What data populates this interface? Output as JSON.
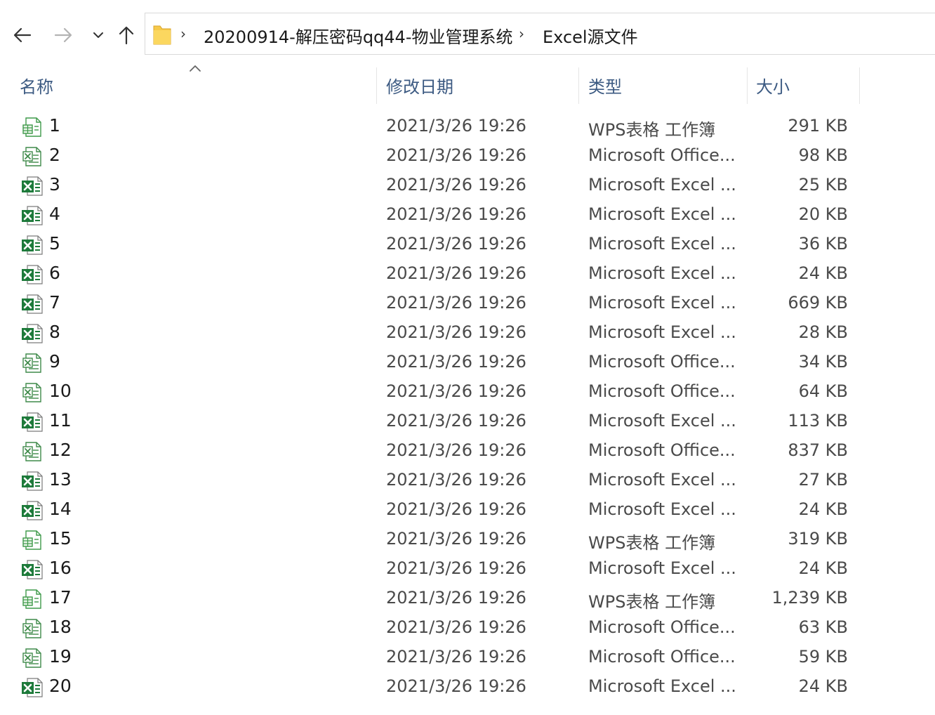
{
  "nav": {
    "back_icon": "arrow-left-icon",
    "forward_icon": "arrow-right-icon",
    "recent_icon": "chevron-down-icon",
    "up_icon": "arrow-up-icon"
  },
  "address": {
    "folder_icon": "folder-icon",
    "crumbs": [
      "20200914-解压密码qq44-物业管理系统",
      "Excel源文件"
    ]
  },
  "columns": {
    "name": "名称",
    "date": "修改日期",
    "type": "类型",
    "size": "大小"
  },
  "colors": {
    "excel_green": "#1d7a3a",
    "wps_green": "#3f9a4a",
    "header_text": "#3c5a82",
    "folder_yellow": "#f6c94a"
  },
  "files": [
    {
      "name": "1",
      "date": "2021/3/26 19:26",
      "type": "WPS表格 工作簿",
      "size": "291 KB",
      "icon": "wps"
    },
    {
      "name": "2",
      "date": "2021/3/26 19:26",
      "type": "Microsoft Office...",
      "size": "98 KB",
      "icon": "office"
    },
    {
      "name": "3",
      "date": "2021/3/26 19:26",
      "type": "Microsoft Excel ...",
      "size": "25 KB",
      "icon": "excel"
    },
    {
      "name": "4",
      "date": "2021/3/26 19:26",
      "type": "Microsoft Excel ...",
      "size": "20 KB",
      "icon": "excel"
    },
    {
      "name": "5",
      "date": "2021/3/26 19:26",
      "type": "Microsoft Excel ...",
      "size": "36 KB",
      "icon": "excel"
    },
    {
      "name": "6",
      "date": "2021/3/26 19:26",
      "type": "Microsoft Excel ...",
      "size": "24 KB",
      "icon": "excel"
    },
    {
      "name": "7",
      "date": "2021/3/26 19:26",
      "type": "Microsoft Excel ...",
      "size": "669 KB",
      "icon": "excel"
    },
    {
      "name": "8",
      "date": "2021/3/26 19:26",
      "type": "Microsoft Excel ...",
      "size": "28 KB",
      "icon": "excel"
    },
    {
      "name": "9",
      "date": "2021/3/26 19:26",
      "type": "Microsoft Office...",
      "size": "34 KB",
      "icon": "office"
    },
    {
      "name": "10",
      "date": "2021/3/26 19:26",
      "type": "Microsoft Office...",
      "size": "64 KB",
      "icon": "office"
    },
    {
      "name": "11",
      "date": "2021/3/26 19:26",
      "type": "Microsoft Excel ...",
      "size": "113 KB",
      "icon": "excel"
    },
    {
      "name": "12",
      "date": "2021/3/26 19:26",
      "type": "Microsoft Office...",
      "size": "837 KB",
      "icon": "office"
    },
    {
      "name": "13",
      "date": "2021/3/26 19:26",
      "type": "Microsoft Excel ...",
      "size": "27 KB",
      "icon": "excel"
    },
    {
      "name": "14",
      "date": "2021/3/26 19:26",
      "type": "Microsoft Excel ...",
      "size": "24 KB",
      "icon": "excel"
    },
    {
      "name": "15",
      "date": "2021/3/26 19:26",
      "type": "WPS表格 工作簿",
      "size": "319 KB",
      "icon": "wps"
    },
    {
      "name": "16",
      "date": "2021/3/26 19:26",
      "type": "Microsoft Excel ...",
      "size": "24 KB",
      "icon": "excel"
    },
    {
      "name": "17",
      "date": "2021/3/26 19:26",
      "type": "WPS表格 工作簿",
      "size": "1,239 KB",
      "icon": "wps"
    },
    {
      "name": "18",
      "date": "2021/3/26 19:26",
      "type": "Microsoft Office...",
      "size": "63 KB",
      "icon": "office"
    },
    {
      "name": "19",
      "date": "2021/3/26 19:26",
      "type": "Microsoft Office...",
      "size": "59 KB",
      "icon": "office"
    },
    {
      "name": "20",
      "date": "2021/3/26 19:26",
      "type": "Microsoft Excel ...",
      "size": "24 KB",
      "icon": "excel"
    }
  ]
}
